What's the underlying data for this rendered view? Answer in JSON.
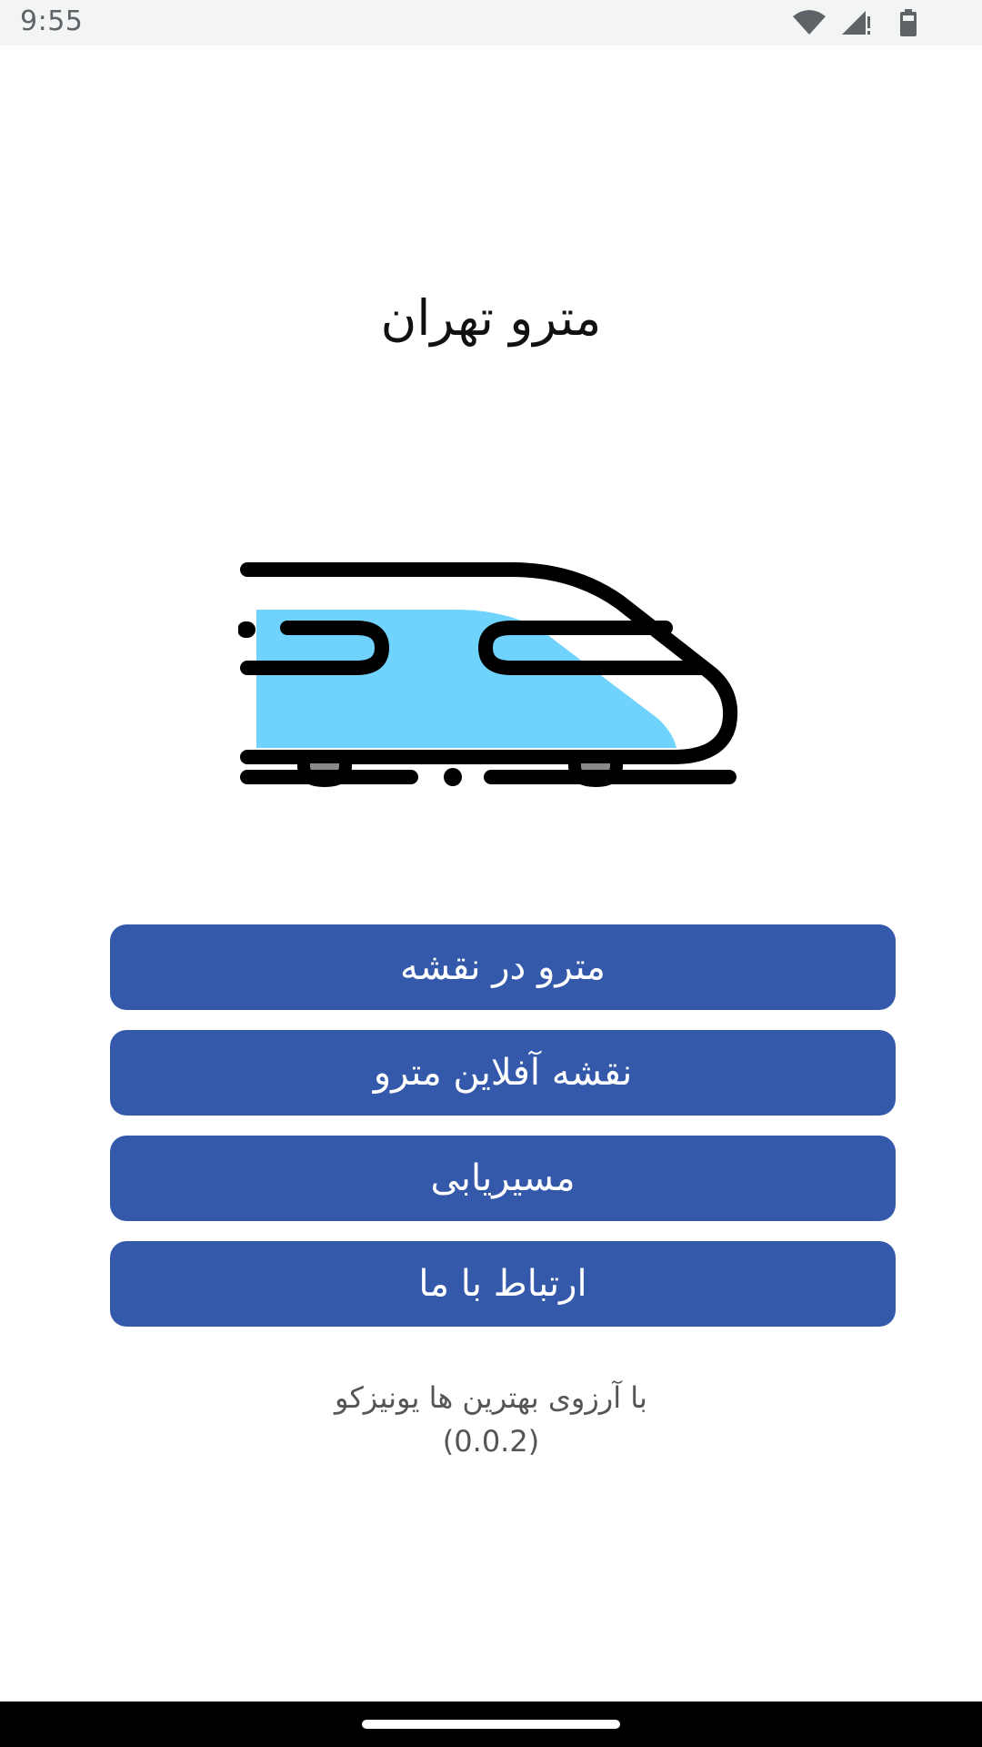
{
  "status_bar": {
    "time": "9:55",
    "icons": [
      "wifi-icon",
      "cellular-signal-icon",
      "battery-icon"
    ]
  },
  "app": {
    "title": "مترو تهران"
  },
  "illustration": {
    "icon": "train-icon",
    "colors": {
      "outline": "#000000",
      "body_fill": "#6fd3fd",
      "wheel_fill": "#8a8a8a"
    }
  },
  "menu": {
    "items": [
      {
        "label": "مترو در نقشه"
      },
      {
        "label": "نقشه آفلاین مترو"
      },
      {
        "label": "مسیریابی"
      },
      {
        "label": "ارتباط با ما"
      }
    ]
  },
  "footer": {
    "tagline": "با آرزوی بهترین ها یونیزکو",
    "version": "(0.0.2)"
  },
  "theme": {
    "button_color": "#3459ab",
    "button_text_color": "#ffffff",
    "background": "#ffffff"
  }
}
